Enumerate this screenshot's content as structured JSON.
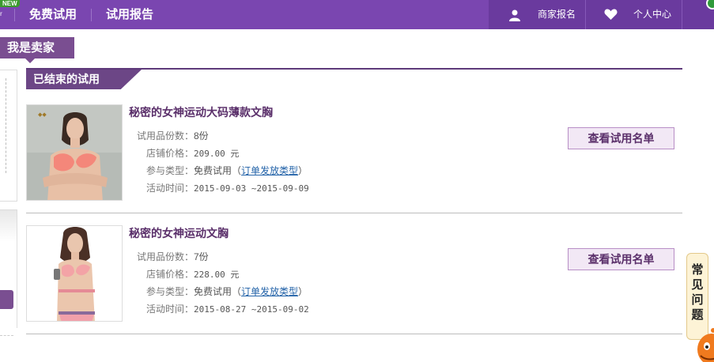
{
  "topbar": {
    "new_badge": "NEW",
    "edge_mark": "ʳ",
    "nav": [
      {
        "label": "免费试用"
      },
      {
        "label": "试用报告"
      }
    ],
    "right": [
      {
        "label": "商家报名",
        "icon": "user-icon"
      },
      {
        "label": "个人中心",
        "icon": "heart-icon"
      }
    ]
  },
  "sidebar": {
    "seller_tab": "我是卖家"
  },
  "section": {
    "title": "已结束的试用"
  },
  "trials": [
    {
      "title": "秘密的女神运动大码薄款文胸",
      "rows": [
        {
          "label": "试用品份数：",
          "value": "8份"
        },
        {
          "label": "店铺价格：",
          "value": "209.00 元"
        },
        {
          "label": "参与类型：",
          "value": "免费试用（",
          "link": "订单发放类型",
          "suffix": "）"
        },
        {
          "label": "活动时间：",
          "value": "2015-09-03 ~2015-09-09"
        }
      ],
      "button": "查看试用名单"
    },
    {
      "title": "秘密的女神运动文胸",
      "rows": [
        {
          "label": "试用品份数：",
          "value": "7份"
        },
        {
          "label": "店铺价格：",
          "value": "228.00 元"
        },
        {
          "label": "参与类型：",
          "value": "免费试用（",
          "link": "订单发放类型",
          "suffix": "）"
        },
        {
          "label": "活动时间：",
          "value": "2015-08-27 ~2015-09-02"
        }
      ],
      "button": "查看试用名单"
    }
  ],
  "faq": {
    "chars": [
      "常",
      "见",
      "问",
      "题"
    ]
  },
  "colors": {
    "nav_purple": "#7a46b0",
    "section_purple": "#6c4686",
    "title_purple": "#5a2f6a",
    "link_blue": "#2262a8"
  }
}
